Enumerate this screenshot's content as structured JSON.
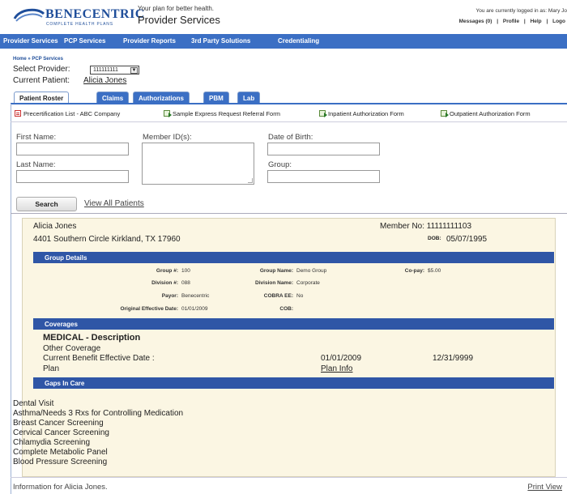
{
  "header": {
    "brand": "BENECENTRIC",
    "brand_sub": "COMPLETE HEALTH PLANS",
    "tagline": "Your plan for better health.",
    "title": "Provider Services",
    "logged_in": "You are currently logged in as: Mary Jo",
    "links": [
      "Messages (0)",
      "|",
      "Profile",
      "|",
      "Help",
      "|",
      "Logo"
    ]
  },
  "nav": [
    "Provider Services",
    "PCP Services",
    "Provider Reports",
    "3rd Party Solutions",
    "Credentialing"
  ],
  "breadcrumb": "Home  »  PCP Services",
  "select_provider": {
    "label": "Select Provider:",
    "value": "111111111"
  },
  "current_patient": {
    "label": "Current Patient:",
    "name": "Alicia Jones"
  },
  "tabs": [
    "Patient Roster",
    "Claims",
    "Authorizations",
    "PBM",
    "Lab"
  ],
  "forms": [
    {
      "label": "Precertification List - ABC Company",
      "icon": "pdf-icon"
    },
    {
      "label": "Sample Express Request Referral Form",
      "icon": "document-icon"
    },
    {
      "label": "Inpatient Authorization Form",
      "icon": "document-icon"
    },
    {
      "label": "Outpatient Authorization Form",
      "icon": "document-icon"
    }
  ],
  "search_form": {
    "first_name": "First Name:",
    "last_name": "Last Name:",
    "member_ids": "Member ID(s):",
    "dob": "Date of Birth:",
    "group": "Group:",
    "search_button": "Search",
    "view_all": "View All Patients"
  },
  "patient": {
    "name": "Alicia Jones",
    "address": "4401 Southern Circle Kirkland, TX 17960",
    "member_no": "Member No: 11111111103",
    "dob_label": "DOB:",
    "dob": "05/07/1995"
  },
  "group_details": {
    "title": "Group Details",
    "group_no_label": "Group #:",
    "group_no": "100",
    "division_no_label": "Division #:",
    "division_no": "088",
    "payor_label": "Payor:",
    "payor": "Benecentric",
    "orig_eff_label": "Original Effective Date:",
    "orig_eff": "01/01/2009",
    "group_name_label": "Group Name:",
    "group_name": "Demo Group",
    "division_name_label": "Division Name:",
    "division_name": "Corporate",
    "cobra_label": "COBRA EE:",
    "cobra": "No",
    "cob_label": "COB:",
    "copay_label": "Co-pay:",
    "copay": "$5.00"
  },
  "coverages": {
    "title": "Coverages",
    "heading": "MEDICAL - Description",
    "other": "Other Coverage",
    "benefit_label": "Current Benefit Effective Date :",
    "plan_label": "Plan",
    "start": "01/01/2009",
    "end": "12/31/9999",
    "plan_info": "Plan Info"
  },
  "gaps": {
    "title": "Gaps In Care",
    "items": [
      "Dental Visit",
      "Asthma/Needs 3 Rxs for Controlling Medication",
      "Breast Cancer Screening",
      "Cervical Cancer Screening",
      "Chlamydia Screening",
      "Complete Metabolic Panel",
      "Blood Pressure Screening"
    ]
  },
  "footer": {
    "info": "Information for Alicia Jones.",
    "print_view": "Print View"
  }
}
